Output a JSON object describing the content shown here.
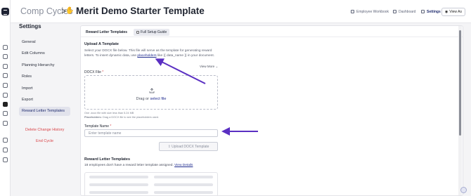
{
  "header": {
    "breadcrumb": "Comp Cycles",
    "separator": ">",
    "title": "Merit Demo Starter Template",
    "nav": {
      "employee_workbook": "Employee Workbook",
      "dashboard": "Dashboard",
      "settings": "Settings",
      "view_as": "View As"
    }
  },
  "sidebar": {
    "title": "Settings",
    "items": [
      {
        "label": "General"
      },
      {
        "label": "Edit Columns"
      },
      {
        "label": "Planning Hierarchy"
      },
      {
        "label": "Roles"
      },
      {
        "label": "Import"
      },
      {
        "label": "Export"
      },
      {
        "label": "Reward Letter Templates"
      }
    ],
    "active_item": "Reward Letter Templates",
    "danger_items": [
      {
        "label": "Delete Change History"
      },
      {
        "label": "End Cycle"
      }
    ]
  },
  "tabs": [
    {
      "label": "Reward Letter Templates"
    },
    {
      "label": "Full Setup Guide"
    }
  ],
  "upload": {
    "title": "Upload A Template",
    "desc_1": "Select your DOCX file below. This file will serve as the template for generating reward letters. To insert dynamic data, use",
    "desc_link": "placeholders",
    "desc_2": "like {{ data_name }} in your document.",
    "view_more": "View More",
    "docx_label": "DOCX File",
    "required_mark": "*",
    "drop_text": "Drag or",
    "drop_link": "select file",
    "hint_1": "One .docx file with size less than 5.24 MB",
    "hint_2_label": "Placeholders:",
    "hint_2": "Drag a DOCX file to see the placeholders used.",
    "template_name_label": "Template Name",
    "template_name_placeholder": "Enter template name",
    "upload_button": "Upload DOCX Template"
  },
  "reward_letters": {
    "title": "Reward Letter Templates",
    "notice": "18 employees don't have a reward letter template assigned.",
    "notice_link": "View Details"
  },
  "colors": {
    "accent": "#1f2b8e",
    "arrow": "#5a2fc2",
    "danger": "#d9464a"
  }
}
